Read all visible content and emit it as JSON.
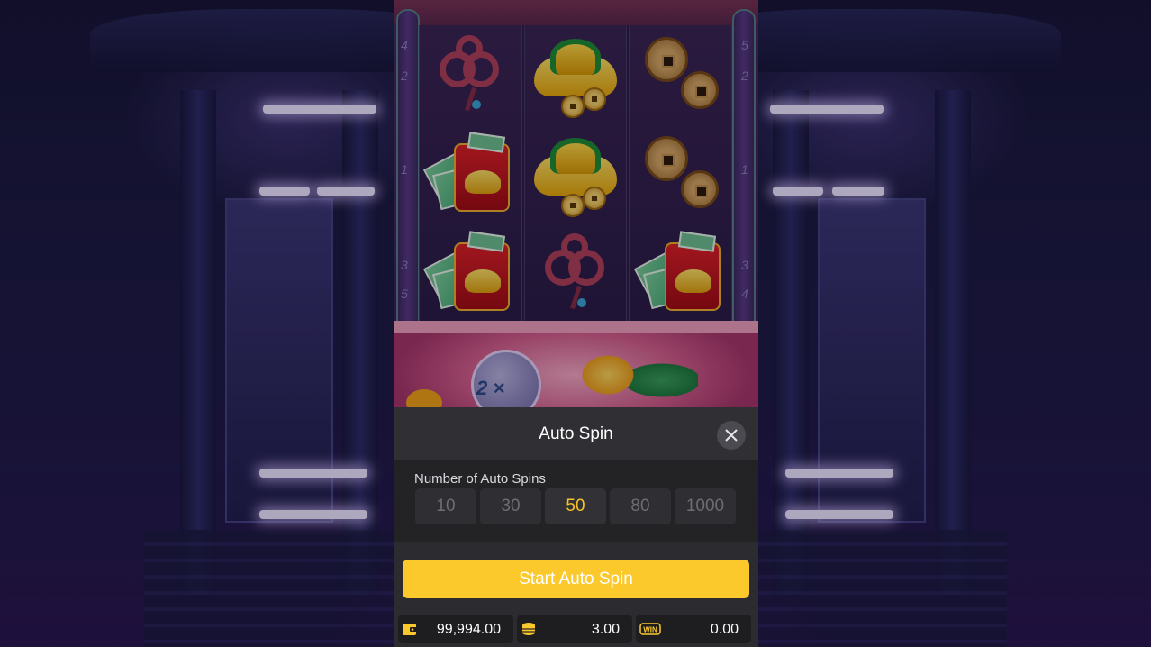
{
  "modal": {
    "title": "Auto Spin",
    "close_icon": "close-icon",
    "spins_label": "Number of Auto Spins",
    "spin_options": [
      "10",
      "30",
      "50",
      "80",
      "1000"
    ],
    "selected_option": "50",
    "start_label": "Start Auto Spin"
  },
  "stats": {
    "balance": "99,994.00",
    "bet": "3.00",
    "win": "0.00",
    "win_badge": "WIN"
  },
  "game": {
    "paylines_left": [
      "4",
      "2",
      "1",
      "3",
      "5"
    ],
    "paylines_right": [
      "5",
      "2",
      "1",
      "3",
      "4"
    ],
    "multiplier": "2 ×",
    "reels": [
      [
        "chinese-knot",
        "red-envelope",
        "red-envelope"
      ],
      [
        "gold-ingot",
        "gold-ingot",
        "chinese-knot"
      ],
      [
        "copper-coins",
        "copper-coins",
        "red-envelope"
      ]
    ]
  },
  "colors": {
    "accent": "#fcc92c",
    "selected_text": "#f8c227",
    "modal_bg": "#2c2c30"
  }
}
